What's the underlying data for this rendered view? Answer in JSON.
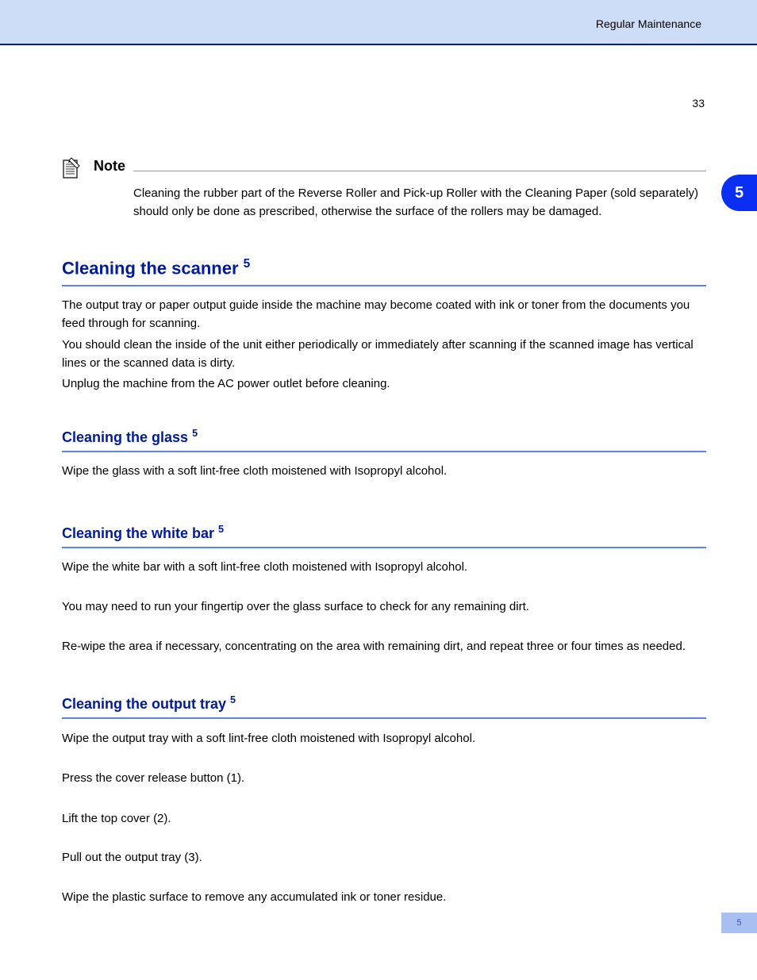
{
  "header": {
    "runningTitle": "Regular Maintenance"
  },
  "pageNumber": "33",
  "sectionTab": "5",
  "footerTab": "5",
  "note": {
    "heading": "Note",
    "body": "Cleaning the rubber part of the Reverse Roller and Pick-up Roller with the Cleaning Paper (sold separately) should only be done as prescribed, otherwise the surface of the rollers may be damaged."
  },
  "sections": {
    "scanner": {
      "heading": "Cleaning the scanner",
      "marker": "5",
      "p1": "The output tray or paper output guide inside the machine may become coated with ink or toner from the documents you feed through for scanning.",
      "p2": "You should clean the inside of the unit either periodically or immediately after scanning if the scanned image has vertical lines or the scanned data is dirty.",
      "p3": "Unplug the machine from the AC power outlet before cleaning."
    },
    "glass": {
      "heading": "Cleaning the glass",
      "marker": "5",
      "p1": "Wipe the glass with a soft lint-free cloth moistened with Isopropyl alcohol."
    },
    "whiteBar": {
      "heading": "Cleaning the white bar",
      "marker": "5",
      "p1": "Wipe the white bar with a soft lint-free cloth moistened with Isopropyl alcohol.",
      "p2": "You may need to run your fingertip over the glass surface to check for any remaining dirt.",
      "p3": "Re-wipe the area if necessary, concentrating on the area with remaining dirt, and repeat three or four times as needed."
    },
    "outTray": {
      "heading": "Cleaning the output tray",
      "marker": "5",
      "p1": "Wipe the output tray with a soft lint-free cloth moistened with Isopropyl alcohol.",
      "p2": "Press the cover release button (1).",
      "p3": "Lift the top cover (2).",
      "p4": "Pull out the output tray (3).",
      "p5": "Wipe the plastic surface to remove any accumulated ink or toner residue."
    }
  }
}
